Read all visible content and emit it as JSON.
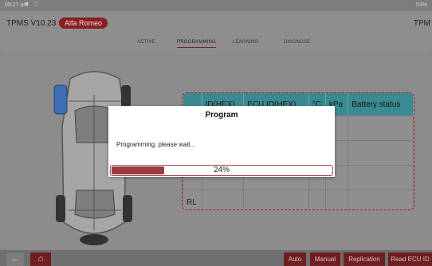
{
  "status_bar": {
    "time": "09:27 am",
    "battery": "53%"
  },
  "header": {
    "app_title": "TPMS V10.23 >",
    "brand": "Alfa Romeo",
    "right_title": "TPM"
  },
  "tabs": [
    {
      "label": "ACTIVE"
    },
    {
      "label": "PROGRAMMING"
    },
    {
      "label": "LEARNING"
    },
    {
      "label": "DIAGNOSE"
    }
  ],
  "table": {
    "headers": [
      "ID(HEX)",
      "ECU ID(HEX)",
      "°C",
      "kPa",
      "Battery status"
    ],
    "row_labels": [
      "",
      "",
      "",
      "RL"
    ]
  },
  "dialog": {
    "title": "Program",
    "message": "Programming, please wait...",
    "progress_percent": 24,
    "progress_text": "24%"
  },
  "bottom_bar": {
    "buttons": [
      {
        "label": "Auto"
      },
      {
        "label": "Manual"
      },
      {
        "label": "Replication"
      },
      {
        "label": "Read ECU ID"
      }
    ]
  },
  "colors": {
    "accent": "#8a1e23",
    "table_header": "#3a8a91",
    "progress": "#9b3a40"
  }
}
